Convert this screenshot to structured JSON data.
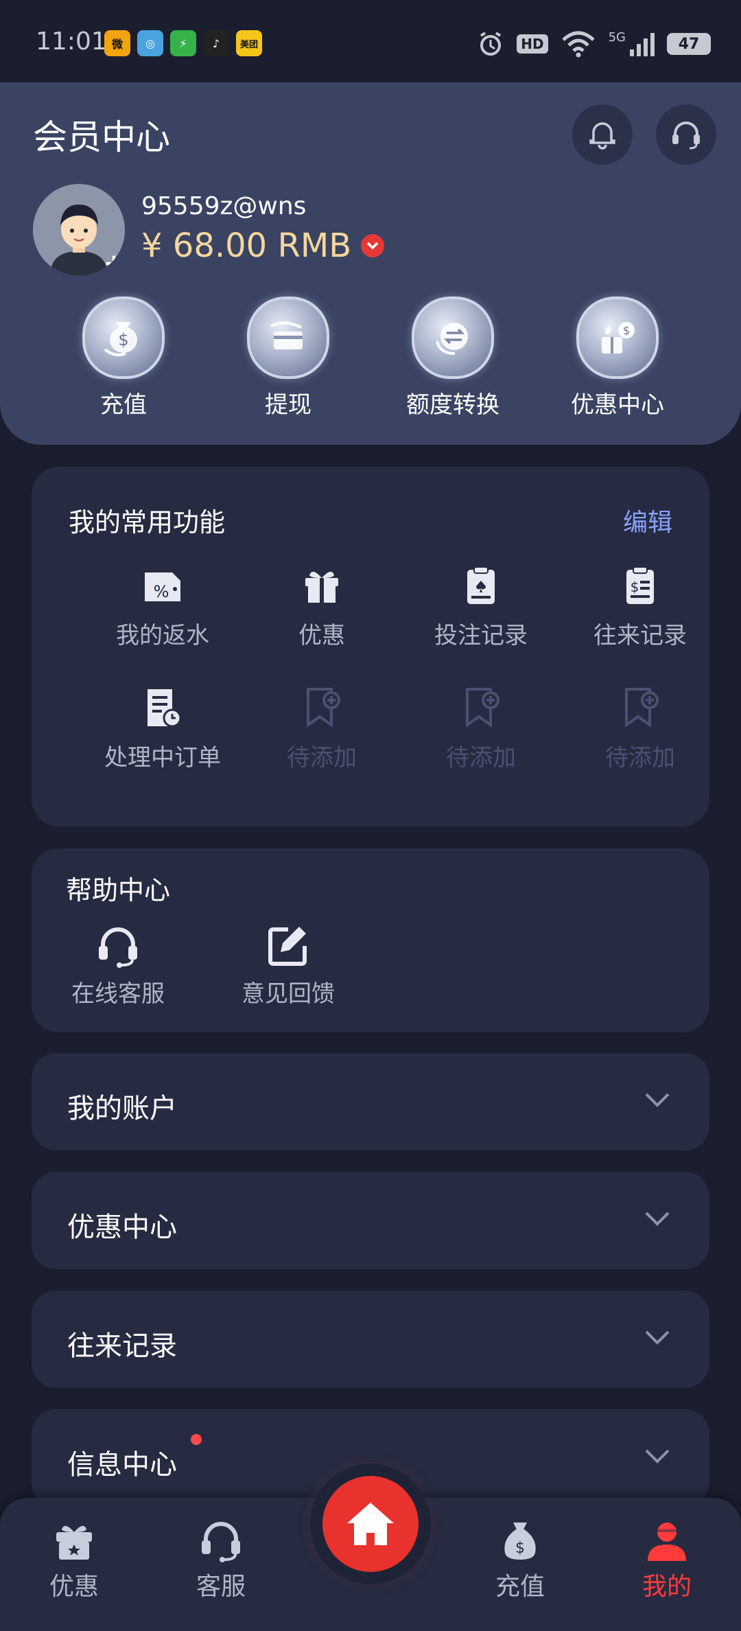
{
  "status_bar": {
    "time": "11:01",
    "apps": [
      {
        "name": "weibo-icon",
        "color": "#f2a30f",
        "glyph": "微"
      },
      {
        "name": "browser-icon",
        "color": "#4aa3df",
        "glyph": "◎"
      },
      {
        "name": "shield-app-icon",
        "color": "#35b24a",
        "glyph": "⚡"
      },
      {
        "name": "tiktok-icon",
        "color": "#222222",
        "glyph": "♪"
      },
      {
        "name": "meituan-icon",
        "color": "#f5c518",
        "glyph": "美团"
      }
    ],
    "hd": "HD",
    "network": "5G",
    "battery": "47"
  },
  "header": {
    "title": "会员中心",
    "username": "95559z@wns",
    "balance": "¥ 68.00 RMB",
    "actions": [
      {
        "label": "充值",
        "icon": "money-bag-icon"
      },
      {
        "label": "提现",
        "icon": "withdraw-card-icon"
      },
      {
        "label": "额度转换",
        "icon": "transfer-icon"
      },
      {
        "label": "优惠中心",
        "icon": "promo-gift-icon"
      }
    ]
  },
  "favorites": {
    "title": "我的常用功能",
    "edit": "编辑",
    "items": [
      {
        "label": "我的返水",
        "icon": "rebate-icon",
        "enabled": true
      },
      {
        "label": "优惠",
        "icon": "gift-icon",
        "enabled": true
      },
      {
        "label": "投注记录",
        "icon": "bet-record-icon",
        "enabled": true
      },
      {
        "label": "往来记录",
        "icon": "transaction-record-icon",
        "enabled": true
      },
      {
        "label": "处理中订单",
        "icon": "pending-order-icon",
        "enabled": true
      },
      {
        "label": "待添加",
        "icon": "bookmark-add-icon",
        "enabled": false
      },
      {
        "label": "待添加",
        "icon": "bookmark-add-icon",
        "enabled": false
      },
      {
        "label": "待添加",
        "icon": "bookmark-add-icon",
        "enabled": false
      }
    ]
  },
  "help": {
    "title": "帮助中心",
    "items": [
      {
        "label": "在线客服",
        "icon": "headset-icon"
      },
      {
        "label": "意见回馈",
        "icon": "edit-feedback-icon"
      }
    ]
  },
  "sections": [
    {
      "title": "我的账户",
      "dot": false
    },
    {
      "title": "优惠中心",
      "dot": false
    },
    {
      "title": "往来记录",
      "dot": false
    },
    {
      "title": "信息中心",
      "dot": true
    }
  ],
  "bottom_nav": {
    "items": [
      {
        "label": "优惠",
        "icon": "gift-icon",
        "active": false
      },
      {
        "label": "客服",
        "icon": "headset-icon",
        "active": false
      },
      {
        "label": "充值",
        "icon": "money-bag-icon",
        "active": false
      },
      {
        "label": "我的",
        "icon": "user-icon",
        "active": true
      }
    ],
    "home_icon": "home-icon"
  },
  "colors": {
    "accent_red": "#e8322e",
    "balance_gold": "#f5d69d",
    "link_blue": "#8aa0ff"
  }
}
